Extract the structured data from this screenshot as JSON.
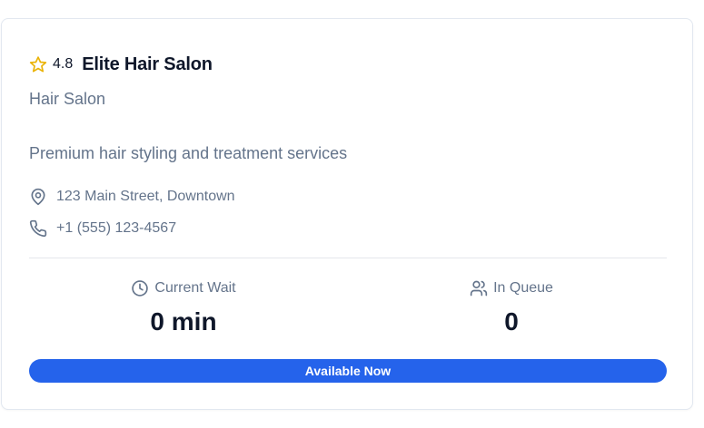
{
  "salon": {
    "rating": "4.8",
    "name": "Elite Hair Salon",
    "category": "Hair Salon",
    "description": "Premium hair styling and treatment services",
    "address": "123 Main Street, Downtown",
    "phone": "+1 (555) 123-4567"
  },
  "stats": {
    "wait_label": "Current Wait",
    "wait_value": "0 min",
    "queue_label": "In Queue",
    "queue_value": "0"
  },
  "status": {
    "label": "Available Now"
  },
  "icons": {
    "rating": "star-icon",
    "address": "map-pin-icon",
    "phone": "phone-icon",
    "wait": "clock-icon",
    "queue": "users-icon"
  },
  "colors": {
    "accent": "#2563eb",
    "star": "#eab308",
    "muted_text": "#64748b",
    "primary_text": "#0f172a",
    "border": "#e2e8f0"
  }
}
